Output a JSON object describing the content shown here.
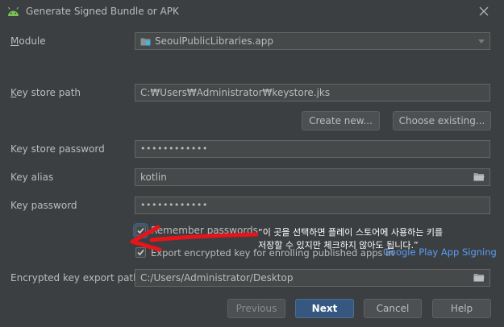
{
  "window": {
    "title": "Generate Signed Bundle or APK",
    "icon": "android-icon",
    "close_icon": "close-icon"
  },
  "form": {
    "module": {
      "label": "Module",
      "value": "SeoulPublicLibraries.app"
    },
    "key_store_path": {
      "label": "Key store path",
      "value": "C:₩Users₩Administrator₩keystore.jks"
    },
    "create_new": "Create new...",
    "choose_existing": "Choose existing...",
    "key_store_password": {
      "label": "Key store password",
      "value": "••••••••••••"
    },
    "key_alias": {
      "label": "Key alias",
      "value": "kotlin"
    },
    "key_password": {
      "label": "Key password",
      "value": "••••••••••••"
    },
    "remember_passwords": {
      "label": "Remember passwords",
      "checked": true
    },
    "export_encrypted": {
      "label": "Export encrypted key for enrolling published apps in",
      "checked": true,
      "link": "Google Play App Signing"
    },
    "encrypted_export_path": {
      "label": "Encrypted key export path",
      "value": "C:/Users/Administrator/Desktop"
    }
  },
  "annotation": {
    "line1": "“이 곳을 선택하면 플레이 스토어에 사용하는 키를",
    "line2": "저장할 수 있지만 체크하지 않아도 됩니다.”",
    "arrow_color": "#e8141a"
  },
  "buttons": {
    "previous": "Previous",
    "next": "Next",
    "cancel": "Cancel",
    "help": "Help"
  },
  "colors": {
    "background": "#3c3f41",
    "field": "#45494a",
    "primary": "#365880",
    "link": "#589df6"
  }
}
